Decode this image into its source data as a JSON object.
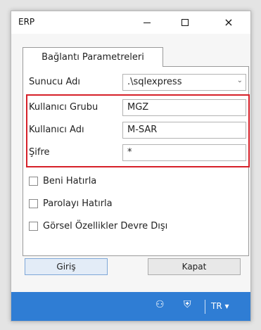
{
  "window": {
    "title": "ERP"
  },
  "titlebar_buttons": {
    "minimize": "minimize-icon",
    "maximize": "maximize-icon",
    "close": "×"
  },
  "tab": {
    "label": "Bağlantı Parametreleri"
  },
  "fields": {
    "server": {
      "label": "Sunucu Adı",
      "value": ".\\sqlexpress",
      "arrow": "⌄"
    },
    "group": {
      "label": "Kullanıcı Grubu",
      "value": "MGZ"
    },
    "user": {
      "label": "Kullanıcı Adı",
      "value": "M-SAR"
    },
    "password": {
      "label": "Şifre",
      "value": "*"
    }
  },
  "checkboxes": [
    {
      "label": "Beni Hatırla",
      "checked": false
    },
    {
      "label": "Parolayı Hatırla",
      "checked": false
    },
    {
      "label": "Görsel Özellikler Devre Dışı",
      "checked": false
    }
  ],
  "buttons": {
    "login": "Giriş",
    "close": "Kapat"
  },
  "statusbar": {
    "people_icon": "⚇",
    "shield_icon": "⛨",
    "language": "TR ▾"
  },
  "colors": {
    "statusbar": "#2f7dd4",
    "highlight_border": "#d62029"
  }
}
